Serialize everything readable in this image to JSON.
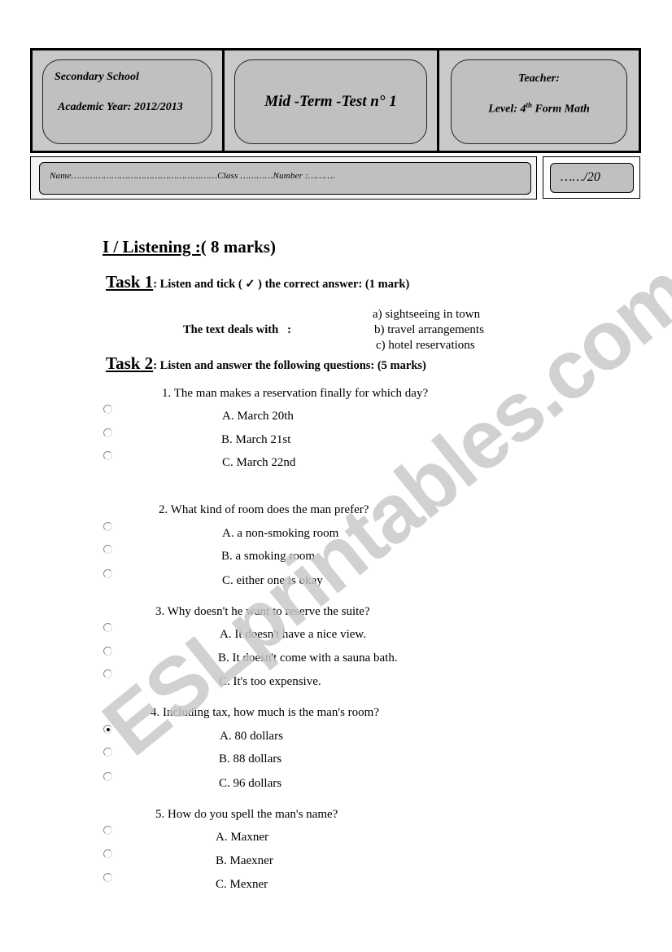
{
  "header": {
    "school": "Secondary School",
    "academic_year": "Academic Year: 2012/2013",
    "test_title": "Mid -Term -Test n° 1",
    "teacher_label": "Teacher:",
    "level_prefix": "Level: 4",
    "level_sup": "th",
    "level_suffix": " Form Math"
  },
  "student_info": {
    "line": "Name………………………………………………Class …………Number :………."
  },
  "score": {
    "text": "……/20"
  },
  "section": {
    "title_underlined": "I / Listening :",
    "title_rest": "( 8 marks)"
  },
  "task1": {
    "name": "Task 1",
    "instruction": ": Listen and tick ( ✓ ) the correct answer:  (1 mark)",
    "prompt": "The text deals with   :",
    "options": [
      "a) sightseeing in town",
      "b) travel arrangements",
      "c) hotel reservations"
    ]
  },
  "task2": {
    "name": "Task 2",
    "instruction": ": Listen and answer the following questions: (5 marks)",
    "questions": [
      {
        "text": "1. The man makes a reservation finally for which day?",
        "options": [
          "A. March 20th",
          "B. March 21st",
          "C. March 22nd"
        ],
        "selected": null
      },
      {
        "text": "2. What kind of room does the man prefer?",
        "options": [
          "A.  a non-smoking room",
          "B.  a smoking room",
          "C.  either one is okay"
        ],
        "selected": null
      },
      {
        "text": "3. Why doesn't he want to reserve the suite?",
        "options": [
          "A.  It doesn't have a nice view.",
          "B.  It doesn't come with a sauna bath.",
          "C.  It's too expensive."
        ],
        "selected": null
      },
      {
        "text": "4. Including tax, how much is the man's room?",
        "options": [
          "A. 80 dollars",
          "B. 88 dollars",
          "C. 96 dollars"
        ],
        "selected": 0
      },
      {
        "text": "5. How do you spell the man's name?",
        "options": [
          "A. Maxner",
          "B. Maexner",
          "C. Mexner"
        ],
        "selected": null
      }
    ]
  },
  "watermark": {
    "text": "ESLprintables.com",
    "color": "#c8c8c8"
  }
}
